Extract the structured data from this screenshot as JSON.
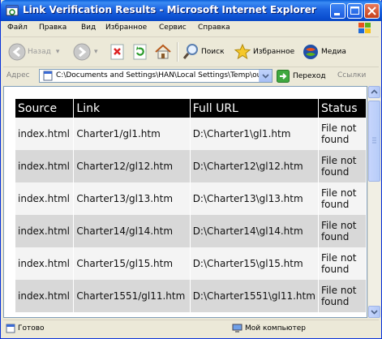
{
  "window": {
    "title": "Link Verification Results - Microsoft Internet Explorer"
  },
  "menu": [
    "Файл",
    "Правка",
    "Вид",
    "Избранное",
    "Сервис",
    "Справка"
  ],
  "toolbar": {
    "back_label": "Назад",
    "search_label": "Поиск",
    "favorites_label": "Избранное",
    "media_label": "Медиа"
  },
  "address": {
    "label": "Адрес",
    "value": "C:\\Documents and Settings\\HAN\\Local Settings\\Temp\\outp",
    "go_label": "Переход",
    "links_label": "Ссылки"
  },
  "table": {
    "headers": [
      "Source",
      "Link",
      "Full URL",
      "Status"
    ],
    "rows": [
      [
        "index.html",
        "Charter1/gl1.htm",
        "D:\\Charter1\\gl1.htm",
        "File not found"
      ],
      [
        "index.html",
        "Charter12/gl12.htm",
        "D:\\Charter12\\gl12.htm",
        "File not found"
      ],
      [
        "index.html",
        "Charter13/gl13.htm",
        "D:\\Charter13\\gl13.htm",
        "File not found"
      ],
      [
        "index.html",
        "Charter14/gl14.htm",
        "D:\\Charter14\\gl14.htm",
        "File not found"
      ],
      [
        "index.html",
        "Charter15/gl15.htm",
        "D:\\Charter15\\gl15.htm",
        "File not found"
      ],
      [
        "index.html",
        "Charter1551/gl11.htm",
        "D:\\Charter1551\\gl11.htm",
        "File not found"
      ]
    ]
  },
  "statusbar": {
    "left": "Готово",
    "right": "Мой компьютер"
  },
  "colors": {
    "title_blue": "#0b4fd0",
    "header_bg": "#000000",
    "row_light": "#f4f4f4",
    "row_dark": "#d8d8d8"
  }
}
